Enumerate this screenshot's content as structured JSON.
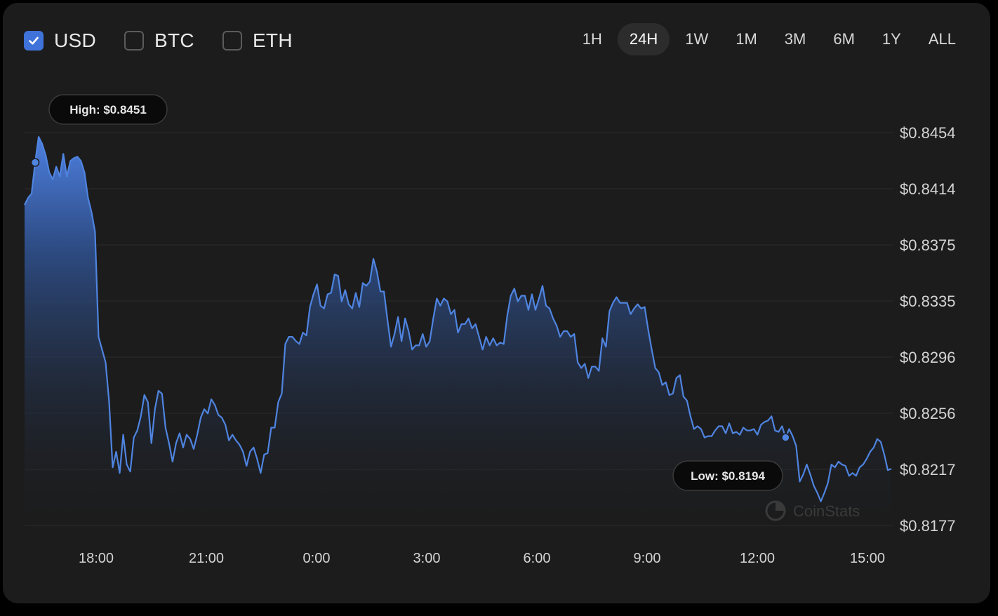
{
  "currencies": [
    {
      "label": "USD",
      "checked": true
    },
    {
      "label": "BTC",
      "checked": false
    },
    {
      "label": "ETH",
      "checked": false
    }
  ],
  "time_ranges": [
    "1H",
    "24H",
    "1W",
    "1M",
    "3M",
    "6M",
    "1Y",
    "ALL"
  ],
  "active_range": "24H",
  "colors": {
    "line": "#4f84e0",
    "accent": "#3f73d9",
    "background": "#1c1c1c"
  },
  "watermark": "CoinStats",
  "chart_data": {
    "type": "area",
    "title": "",
    "xlabel": "",
    "ylabel": "",
    "y_axis_position": "right",
    "yticks": [
      "$0.8454",
      "$0.8414",
      "$0.8375",
      "$0.8335",
      "$0.8296",
      "$0.8256",
      "$0.8217",
      "$0.8177"
    ],
    "ylim": [
      0.8177,
      0.8454
    ],
    "xticks": [
      "18:00",
      "21:00",
      "0:00",
      "3:00",
      "6:00",
      "9:00",
      "12:00",
      "15:00"
    ],
    "grid": true,
    "high_label": "High: $0.8451",
    "low_label": "Low: $0.8194",
    "high_index": 3,
    "low_index": 216,
    "series": [
      {
        "x_start": "16:03",
        "x_end": "15:39",
        "sample_interval_min": 6,
        "values": [
          0.8403,
          0.8408,
          0.8411,
          0.8433,
          0.8451,
          0.8446,
          0.8438,
          0.8426,
          0.8421,
          0.843,
          0.8423,
          0.8439,
          0.8423,
          0.8434,
          0.8436,
          0.8437,
          0.8434,
          0.8426,
          0.8408,
          0.8398,
          0.8384,
          0.831,
          0.8301,
          0.8292,
          0.8264,
          0.8218,
          0.8229,
          0.8214,
          0.8241,
          0.822,
          0.8215,
          0.8239,
          0.8244,
          0.8254,
          0.8269,
          0.8264,
          0.8235,
          0.8259,
          0.8272,
          0.827,
          0.8246,
          0.8235,
          0.8222,
          0.8235,
          0.8242,
          0.8232,
          0.8241,
          0.8238,
          0.8231,
          0.8241,
          0.8253,
          0.8259,
          0.8256,
          0.8266,
          0.8262,
          0.8255,
          0.8253,
          0.8248,
          0.8237,
          0.8241,
          0.8237,
          0.8234,
          0.8229,
          0.8219,
          0.8229,
          0.8232,
          0.8224,
          0.8214,
          0.8227,
          0.8228,
          0.8246,
          0.8246,
          0.8264,
          0.827,
          0.8305,
          0.831,
          0.831,
          0.8307,
          0.8305,
          0.8313,
          0.8311,
          0.8331,
          0.834,
          0.8347,
          0.8332,
          0.833,
          0.834,
          0.8341,
          0.8354,
          0.8353,
          0.8335,
          0.8343,
          0.8333,
          0.833,
          0.8341,
          0.8331,
          0.8348,
          0.8346,
          0.8349,
          0.8365,
          0.8356,
          0.8342,
          0.8342,
          0.8322,
          0.8303,
          0.8312,
          0.8324,
          0.8307,
          0.8323,
          0.8314,
          0.8301,
          0.8304,
          0.8304,
          0.8312,
          0.8303,
          0.8307,
          0.8323,
          0.8337,
          0.8332,
          0.8337,
          0.8335,
          0.8326,
          0.8329,
          0.8313,
          0.8319,
          0.8319,
          0.8323,
          0.8316,
          0.8319,
          0.831,
          0.8301,
          0.831,
          0.8304,
          0.8309,
          0.8304,
          0.8306,
          0.8305,
          0.8325,
          0.8339,
          0.8344,
          0.8335,
          0.8339,
          0.8339,
          0.8329,
          0.834,
          0.8329,
          0.8337,
          0.8346,
          0.8332,
          0.833,
          0.8323,
          0.8318,
          0.831,
          0.8314,
          0.8314,
          0.831,
          0.8312,
          0.8292,
          0.8288,
          0.8291,
          0.8281,
          0.8289,
          0.8289,
          0.8286,
          0.8309,
          0.8303,
          0.8328,
          0.8334,
          0.8338,
          0.8334,
          0.8334,
          0.8334,
          0.8326,
          0.833,
          0.8333,
          0.833,
          0.8331,
          0.8315,
          0.8301,
          0.8288,
          0.8285,
          0.8276,
          0.8278,
          0.8269,
          0.827,
          0.8281,
          0.8283,
          0.8268,
          0.8265,
          0.8254,
          0.8245,
          0.8247,
          0.8245,
          0.8239,
          0.824,
          0.824,
          0.8244,
          0.8247,
          0.8247,
          0.8242,
          0.8249,
          0.8242,
          0.8243,
          0.8241,
          0.8246,
          0.8244,
          0.8244,
          0.8245,
          0.8241,
          0.8248,
          0.825,
          0.8251,
          0.8254,
          0.8244,
          0.8243,
          0.8247,
          0.8239,
          0.8245,
          0.824,
          0.8233,
          0.8208,
          0.8213,
          0.822,
          0.8213,
          0.8205,
          0.82,
          0.8194,
          0.82,
          0.8207,
          0.822,
          0.8218,
          0.8222,
          0.822,
          0.8219,
          0.8212,
          0.8214,
          0.8212,
          0.8218,
          0.822,
          0.8224,
          0.8229,
          0.8232,
          0.8238,
          0.8236,
          0.8227,
          0.8216,
          0.8217
        ]
      }
    ]
  }
}
